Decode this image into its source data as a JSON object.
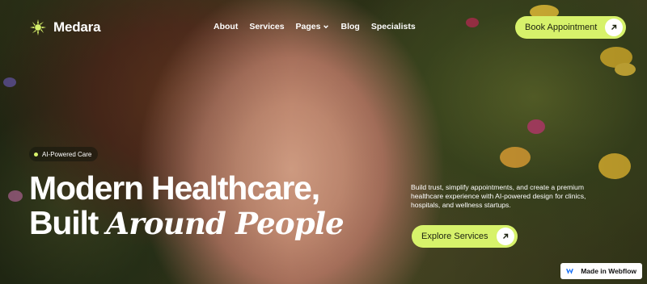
{
  "brand": {
    "name": "Medara"
  },
  "nav": {
    "items": [
      {
        "label": "About"
      },
      {
        "label": "Services"
      },
      {
        "label": "Pages"
      },
      {
        "label": "Blog"
      },
      {
        "label": "Specialists"
      }
    ],
    "cta_label": "Book Appointment"
  },
  "hero": {
    "badge": "AI-Powered Care",
    "headline_line1": "Modern Healthcare,",
    "headline_line2_plain": "Built ",
    "headline_line2_italic": "Around People",
    "description": "Build trust, simplify appointments, and create a premium healthcare experience with AI-powered design for clinics, hospitals, and wellness startups.",
    "cta_label": "Explore Services"
  },
  "webflow_badge": "Made in Webflow",
  "colors": {
    "accent": "#d7f26b",
    "text": "#ffffff"
  },
  "icons": {
    "logo": "sunburst-icon",
    "cta": "arrow-up-right-icon",
    "dropdown": "chevron-down-icon"
  }
}
